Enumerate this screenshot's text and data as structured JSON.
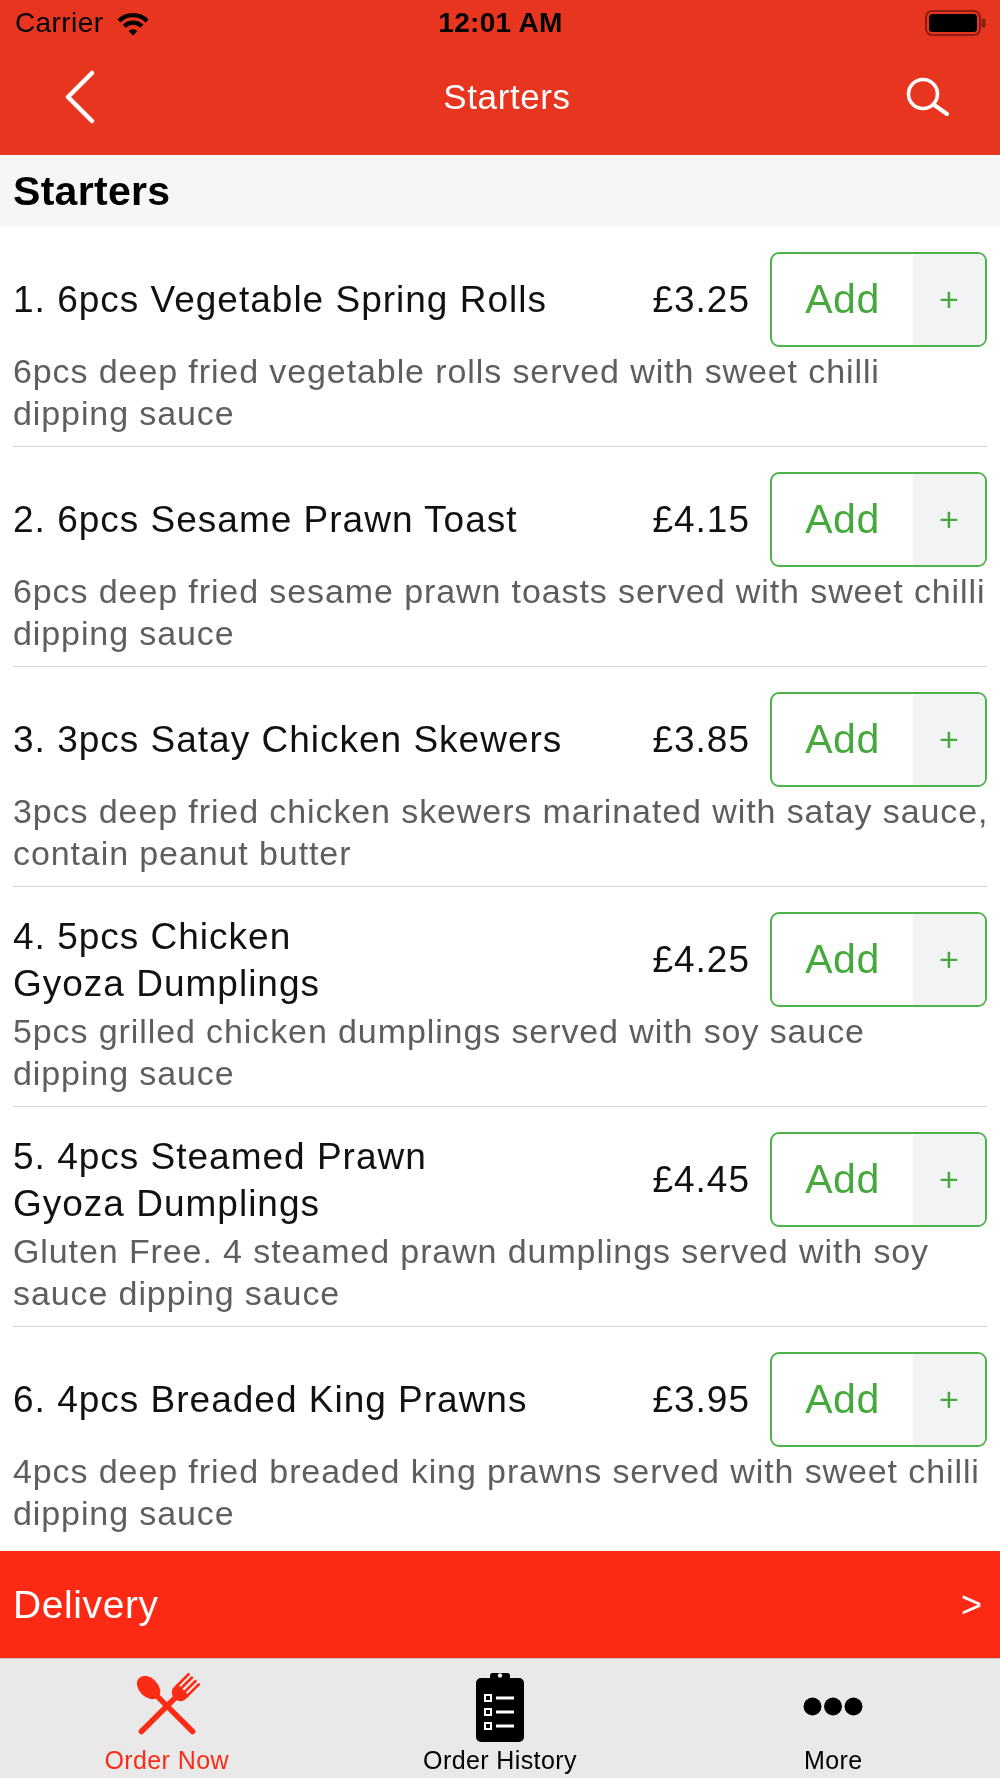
{
  "status_bar": {
    "carrier": "Carrier",
    "time": "12:01 AM"
  },
  "nav_bar": {
    "title": "Starters"
  },
  "section": {
    "title": "Starters"
  },
  "items": [
    {
      "name": "1. 6pcs Vegetable Spring Rolls",
      "price": "£3.25",
      "add_label": "Add",
      "plus": "+",
      "description": "6pcs deep fried vegetable rolls served with sweet chilli dipping sauce"
    },
    {
      "name": "2. 6pcs Sesame Prawn Toast",
      "price": "£4.15",
      "add_label": "Add",
      "plus": "+",
      "description": "6pcs deep fried sesame prawn toasts served with sweet chilli dipping sauce"
    },
    {
      "name": "3. 3pcs Satay Chicken Skewers",
      "price": "£3.85",
      "add_label": "Add",
      "plus": "+",
      "description": "3pcs deep fried chicken skewers marinated with satay sauce, contain peanut butter"
    },
    {
      "name": "4. 5pcs Chicken\nGyoza Dumplings",
      "price": "£4.25",
      "add_label": "Add",
      "plus": "+",
      "description": "5pcs grilled chicken dumplings served with soy sauce dipping sauce"
    },
    {
      "name": "5. 4pcs Steamed Prawn\nGyoza Dumplings",
      "price": "£4.45",
      "add_label": "Add",
      "plus": "+",
      "description": "Gluten Free. 4 steamed prawn dumplings served with soy sauce dipping sauce"
    },
    {
      "name": "6. 4pcs Breaded King Prawns",
      "price": "£3.95",
      "add_label": "Add",
      "plus": "+",
      "description": "4pcs deep fried breaded king prawns served with sweet chilli dipping sauce"
    }
  ],
  "delivery_bar": {
    "label": "Delivery",
    "arrow": ">"
  },
  "tab_bar": {
    "tabs": [
      {
        "label": "Order Now",
        "selected": true
      },
      {
        "label": "Order History",
        "selected": false
      },
      {
        "label": "More",
        "selected": false
      }
    ]
  }
}
